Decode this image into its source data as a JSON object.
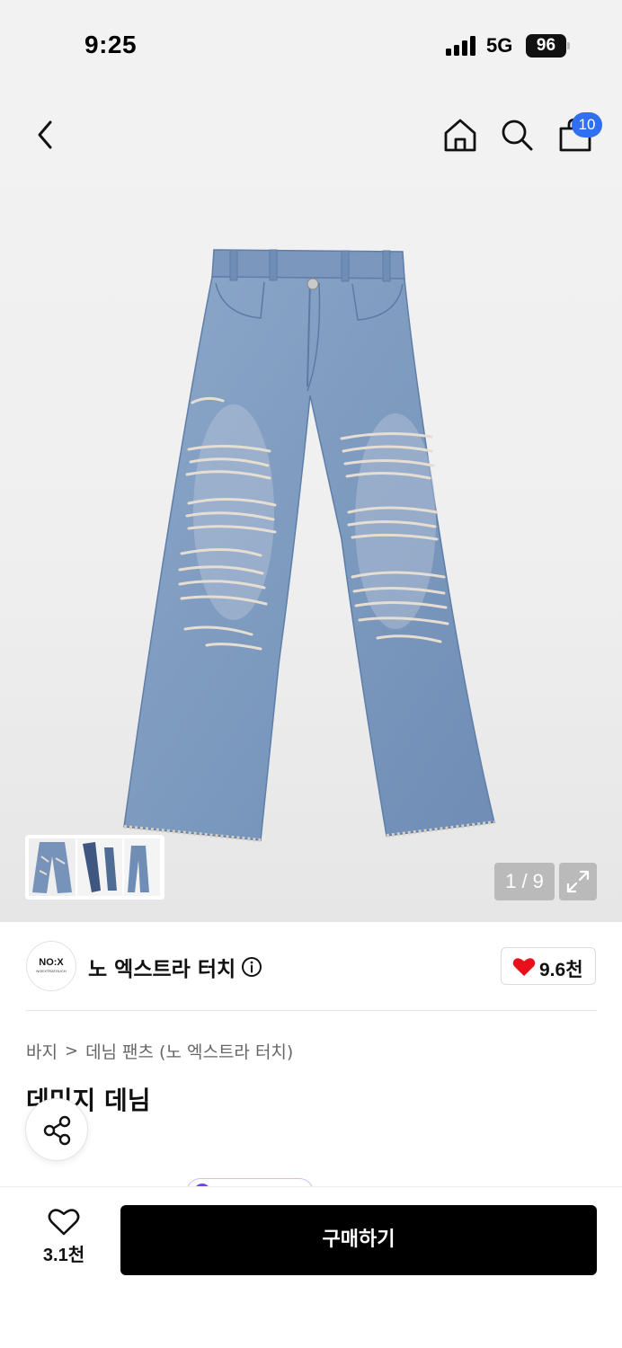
{
  "status_bar": {
    "time": "9:25",
    "network": "5G",
    "battery": "96"
  },
  "header": {
    "back_icon": "chevron-left-icon",
    "home_icon": "home-icon",
    "search_icon": "search-icon",
    "cart_icon": "shopping-bag-icon",
    "cart_badge": "10",
    "badge_color": "#2f6ff0"
  },
  "gallery": {
    "pager": "1 / 9",
    "expand_icon": "expand-icon"
  },
  "brand": {
    "logo_text": "NO:X",
    "logo_subtext": "NOEXTRATOUCH",
    "name": "노 엑스트라 터치",
    "info_icon": "info-icon",
    "like_count": "9.6천",
    "heart_color": "#e8101a"
  },
  "breadcrumb": {
    "category": "바지",
    "separator": ">",
    "subcategory": "데님 팬츠 (노 엑스트라 터치)"
  },
  "product": {
    "title": "데미지 데님"
  },
  "bottom_bar": {
    "wish_count": "3.1천",
    "buy_label": "구매하기"
  }
}
